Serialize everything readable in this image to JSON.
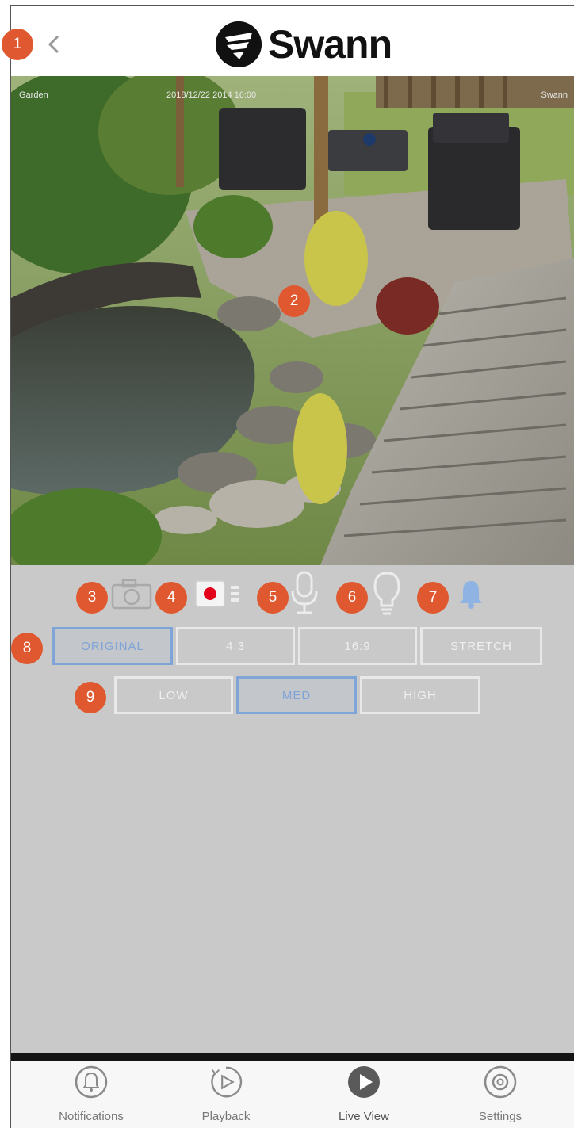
{
  "header": {
    "brand": "Swann",
    "back_icon": "chevron-left-icon"
  },
  "video": {
    "camera_name": "Garden",
    "timestamp": "2018/12/22 2014 16:00",
    "channel_label": "Swann"
  },
  "controls": {
    "icons": [
      "camera-snapshot-icon",
      "record-icon",
      "microphone-icon",
      "light-bulb-icon",
      "bell-icon"
    ]
  },
  "aspect_ratio": {
    "options": [
      "ORIGINAL",
      "4:3",
      "16:9",
      "STRETCH"
    ],
    "selected": "ORIGINAL"
  },
  "quality": {
    "options": [
      "LOW",
      "MED",
      "HIGH"
    ],
    "selected": "MED"
  },
  "callouts": [
    "1",
    "2",
    "3",
    "4",
    "5",
    "6",
    "7",
    "8",
    "9"
  ],
  "tabs": [
    {
      "label": "Notifications",
      "icon": "bell-circle-icon"
    },
    {
      "label": "Playback",
      "icon": "play-outline-icon"
    },
    {
      "label": "Live View",
      "icon": "play-filled-icon"
    },
    {
      "label": "Settings",
      "icon": "gear-icon"
    }
  ],
  "colors": {
    "accent": "#7fa4d8",
    "callout": "#e0582f",
    "panel_bg": "#c9c9c9",
    "record_red": "#e3001b"
  }
}
